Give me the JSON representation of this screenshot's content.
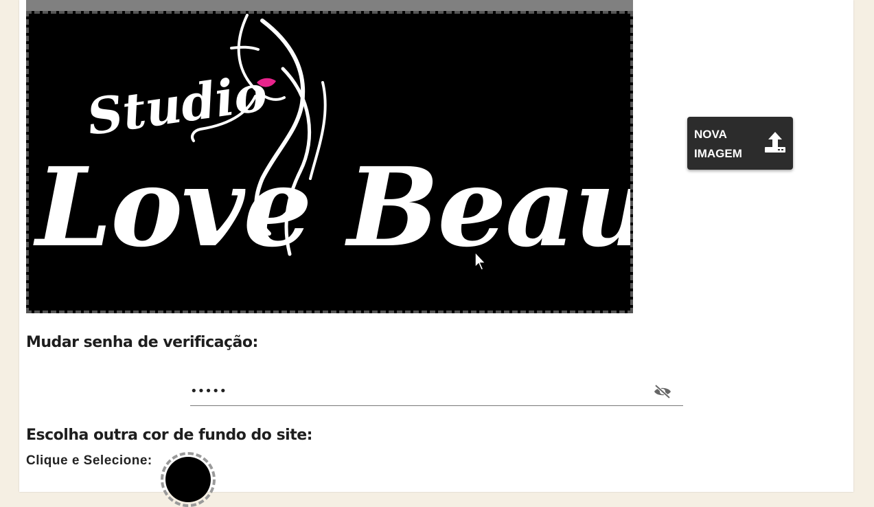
{
  "image_section": {
    "logo_text_top": "Studio",
    "logo_text_main": "Love Beauty",
    "upload_button_label": "NOVA IMAGEM",
    "upload_icon": "upload-tray-icon"
  },
  "password_section": {
    "title": "Mudar senha de verificação:",
    "value": "•••••",
    "toggle_icon": "eye-off-icon"
  },
  "color_section": {
    "title": "Escolha outra cor de fundo do site:",
    "pick_label": "Clique e Selecione:",
    "current_color": "#000000"
  },
  "colors": {
    "page_bg": "#f5efe3",
    "button_bg": "#2c2c2c",
    "lips_accent": "#e8248c"
  }
}
